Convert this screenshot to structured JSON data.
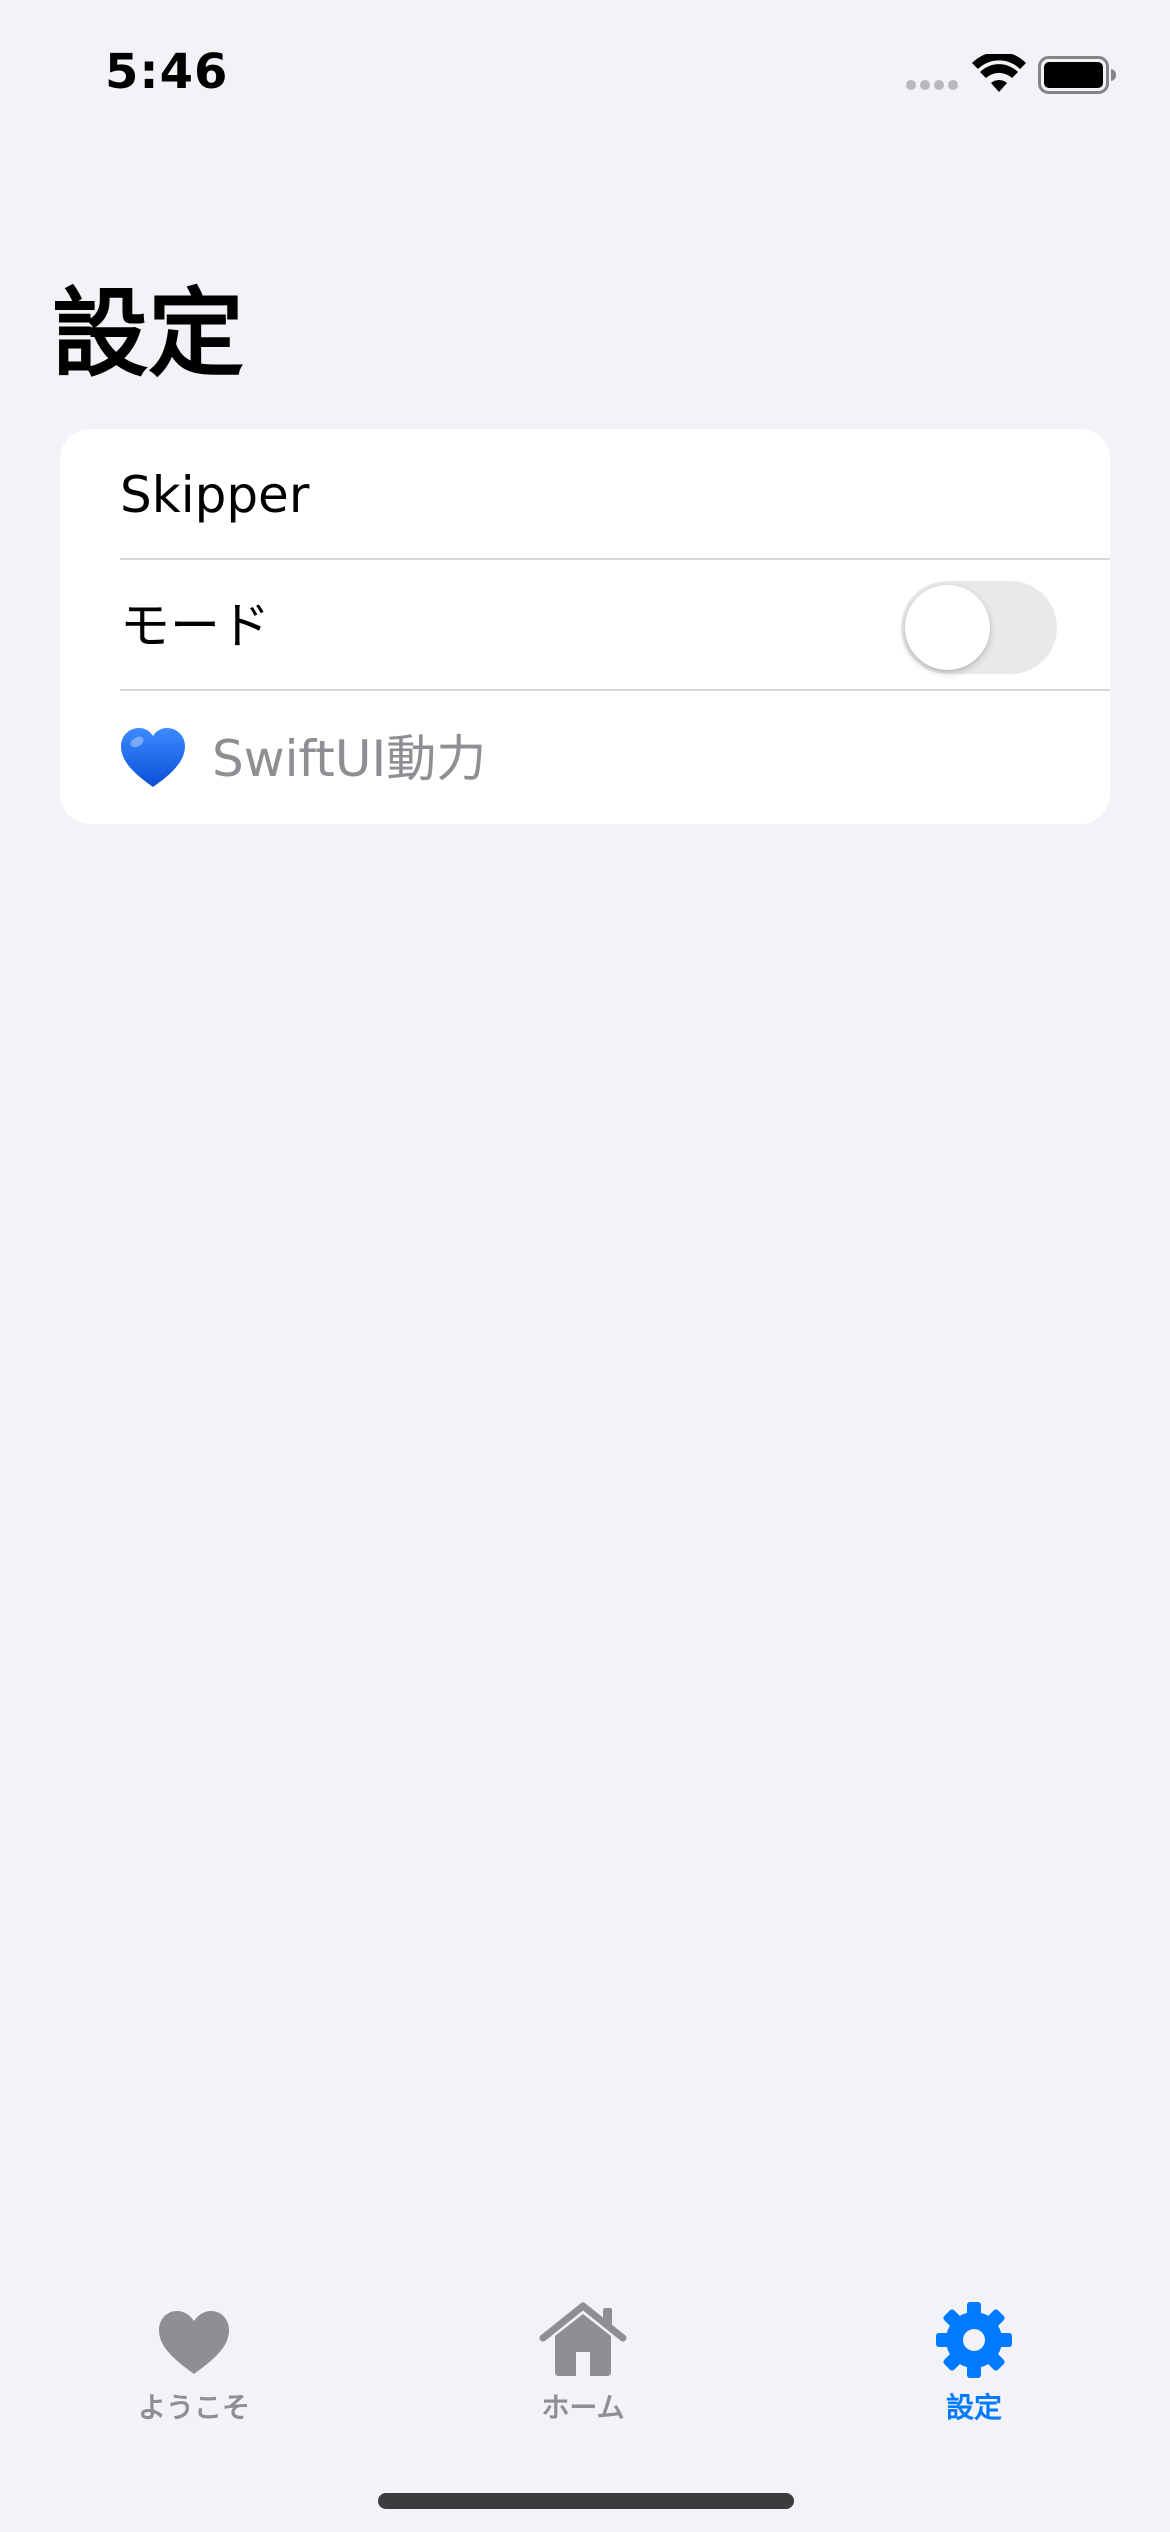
{
  "status_bar": {
    "time": "5:46",
    "signal_icon": "cellular-dots-icon",
    "wifi_icon": "wifi-icon",
    "battery_icon": "battery-full-icon"
  },
  "page": {
    "title": "設定"
  },
  "settings": {
    "rows": [
      {
        "label": "Skipper"
      },
      {
        "label": "モード",
        "toggle_on": false
      },
      {
        "icon": "blue-heart-icon",
        "label": "SwiftUI動力"
      }
    ]
  },
  "tab_bar": {
    "active_color": "#007aff",
    "inactive_color": "#8e8e93",
    "tabs": [
      {
        "label": "ようこそ",
        "icon": "heart-icon",
        "active": false
      },
      {
        "label": "ホーム",
        "icon": "house-icon",
        "active": false
      },
      {
        "label": "設定",
        "icon": "gear-icon",
        "active": true
      }
    ]
  }
}
